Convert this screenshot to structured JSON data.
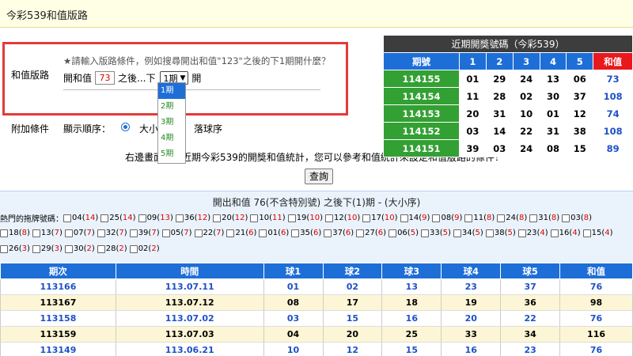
{
  "page_title": "今彩539和值版路",
  "query": {
    "label": "和值版路",
    "hint": "★請輸入版路條件，例如搜尋開出和值\"123\"之後的下1期開什麼？",
    "prefix": "開和值",
    "sum_value": "73",
    "middle": "之後...下",
    "period_selected": "1期",
    "suffix": "開",
    "dropdown_options": [
      "1期",
      "2期",
      "3期",
      "4期",
      "5期"
    ]
  },
  "extra": {
    "label": "附加條件",
    "order_label": "顯示順序：",
    "order_big": "大小",
    "order_other": "落球序"
  },
  "description": "右邊畫面是　近期今彩539的開獎和值統計，您可以參考和值統計來設定和值版路的條件！",
  "query_button": "查詢",
  "recent": {
    "title": "近期開獎號碼（今彩539）",
    "headers": [
      "期號",
      "1",
      "2",
      "3",
      "4",
      "5",
      "和值"
    ],
    "rows": [
      {
        "period": "114155",
        "balls": [
          "01",
          "29",
          "24",
          "13",
          "06"
        ],
        "sum": "73"
      },
      {
        "period": "114154",
        "balls": [
          "11",
          "28",
          "02",
          "30",
          "37"
        ],
        "sum": "108"
      },
      {
        "period": "114153",
        "balls": [
          "20",
          "31",
          "10",
          "01",
          "12"
        ],
        "sum": "74"
      },
      {
        "period": "114152",
        "balls": [
          "03",
          "14",
          "22",
          "31",
          "38"
        ],
        "sum": "108"
      },
      {
        "period": "114151",
        "balls": [
          "39",
          "03",
          "24",
          "08",
          "15"
        ],
        "sum": "89"
      }
    ]
  },
  "result": {
    "title": "開出和值 76(不含特別號) 之後下(1)期 - (大小序)",
    "hot_label": "熱門的拖牌號碼：",
    "hot_numbers": [
      {
        "num": "04",
        "count": "14"
      },
      {
        "num": "25",
        "count": "14"
      },
      {
        "num": "09",
        "count": "13"
      },
      {
        "num": "36",
        "count": "12"
      },
      {
        "num": "20",
        "count": "12"
      },
      {
        "num": "10",
        "count": "11"
      },
      {
        "num": "19",
        "count": "10"
      },
      {
        "num": "12",
        "count": "10"
      },
      {
        "num": "17",
        "count": "10"
      },
      {
        "num": "14",
        "count": "9"
      },
      {
        "num": "08",
        "count": "9"
      },
      {
        "num": "11",
        "count": "8"
      },
      {
        "num": "24",
        "count": "8"
      },
      {
        "num": "31",
        "count": "8"
      },
      {
        "num": "03",
        "count": "8"
      },
      {
        "num": "18",
        "count": "8"
      },
      {
        "num": "13",
        "count": "7"
      },
      {
        "num": "07",
        "count": "7"
      },
      {
        "num": "32",
        "count": "7"
      },
      {
        "num": "39",
        "count": "7"
      },
      {
        "num": "05",
        "count": "7"
      },
      {
        "num": "22",
        "count": "7"
      },
      {
        "num": "21",
        "count": "6"
      },
      {
        "num": "01",
        "count": "6"
      },
      {
        "num": "35",
        "count": "6"
      },
      {
        "num": "37",
        "count": "6"
      },
      {
        "num": "27",
        "count": "6"
      },
      {
        "num": "06",
        "count": "5"
      },
      {
        "num": "33",
        "count": "5"
      },
      {
        "num": "34",
        "count": "5"
      },
      {
        "num": "38",
        "count": "5"
      },
      {
        "num": "23",
        "count": "4"
      },
      {
        "num": "16",
        "count": "4"
      },
      {
        "num": "15",
        "count": "4"
      },
      {
        "num": "26",
        "count": "3"
      },
      {
        "num": "29",
        "count": "3"
      },
      {
        "num": "30",
        "count": "2"
      },
      {
        "num": "28",
        "count": "2"
      },
      {
        "num": "02",
        "count": "2"
      }
    ]
  },
  "history": {
    "headers": [
      "期次",
      "時間",
      "球1",
      "球2",
      "球3",
      "球4",
      "球5",
      "和值"
    ],
    "rows": [
      {
        "period": "113166",
        "date": "113.07.11",
        "balls": [
          "01",
          "02",
          "13",
          "23",
          "37"
        ],
        "sum": "76"
      },
      {
        "period": "113167",
        "date": "113.07.12",
        "balls": [
          "08",
          "17",
          "18",
          "19",
          "36"
        ],
        "sum": "98"
      },
      {
        "period": "113158",
        "date": "113.07.02",
        "balls": [
          "03",
          "15",
          "16",
          "20",
          "22"
        ],
        "sum": "76"
      },
      {
        "period": "113159",
        "date": "113.07.03",
        "balls": [
          "04",
          "20",
          "25",
          "33",
          "34"
        ],
        "sum": "116"
      },
      {
        "period": "113149",
        "date": "113.06.21",
        "balls": [
          "10",
          "12",
          "15",
          "16",
          "23"
        ],
        "sum": "76"
      }
    ]
  },
  "colors": {
    "header_blue": "#1e6ed8",
    "period_green": "#33a033",
    "sum_red": "#e8181c",
    "highlight_border": "#e43a3a",
    "sum_text_blue": "#1e50c8",
    "title_bg": "#ffffe6",
    "panel_bg": "#eaf3fc"
  }
}
